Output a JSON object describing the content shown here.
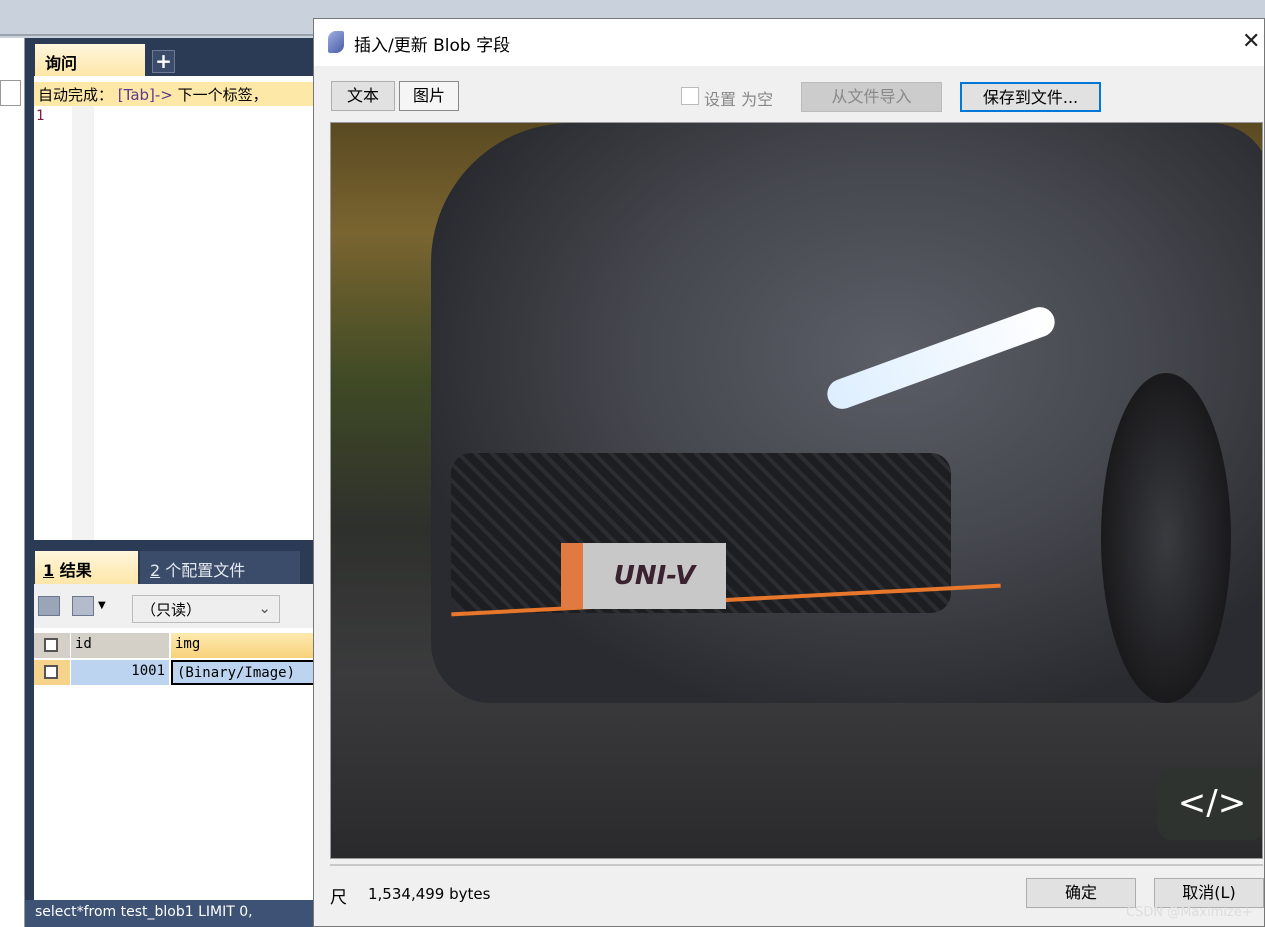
{
  "query_tab": {
    "label": "询问",
    "add_label": "+"
  },
  "editor": {
    "hint_prefix": "自动完成：",
    "hint_key": "[Tab]->",
    "hint_suffix": " 下一个标签，",
    "line_number": "1"
  },
  "results": {
    "tab1_num": "1",
    "tab1_label": " 结果",
    "tab2_num": "2",
    "tab2_label": " 个配置文件",
    "readonly_select": "（只读）",
    "columns": [
      "id",
      "img"
    ],
    "rows": [
      [
        "1001",
        "(Binary/Image)"
      ]
    ]
  },
  "status": "select*from test_blob1 LIMIT 0,",
  "dialog": {
    "title": "插入/更新 Blob 字段",
    "close": "✕",
    "text_tab": "文本",
    "image_tab": "图片",
    "set_null": "设置 为空",
    "set_null_checked": false,
    "import": "从文件导入",
    "save": "保存到文件...",
    "plate_text": "UNI-V",
    "code_icon": "</>",
    "size_icon": "尺",
    "size": "1,534,499 bytes",
    "ok": "确定",
    "cancel": "取消(L)"
  },
  "watermark": "CSDN @Maximize+"
}
